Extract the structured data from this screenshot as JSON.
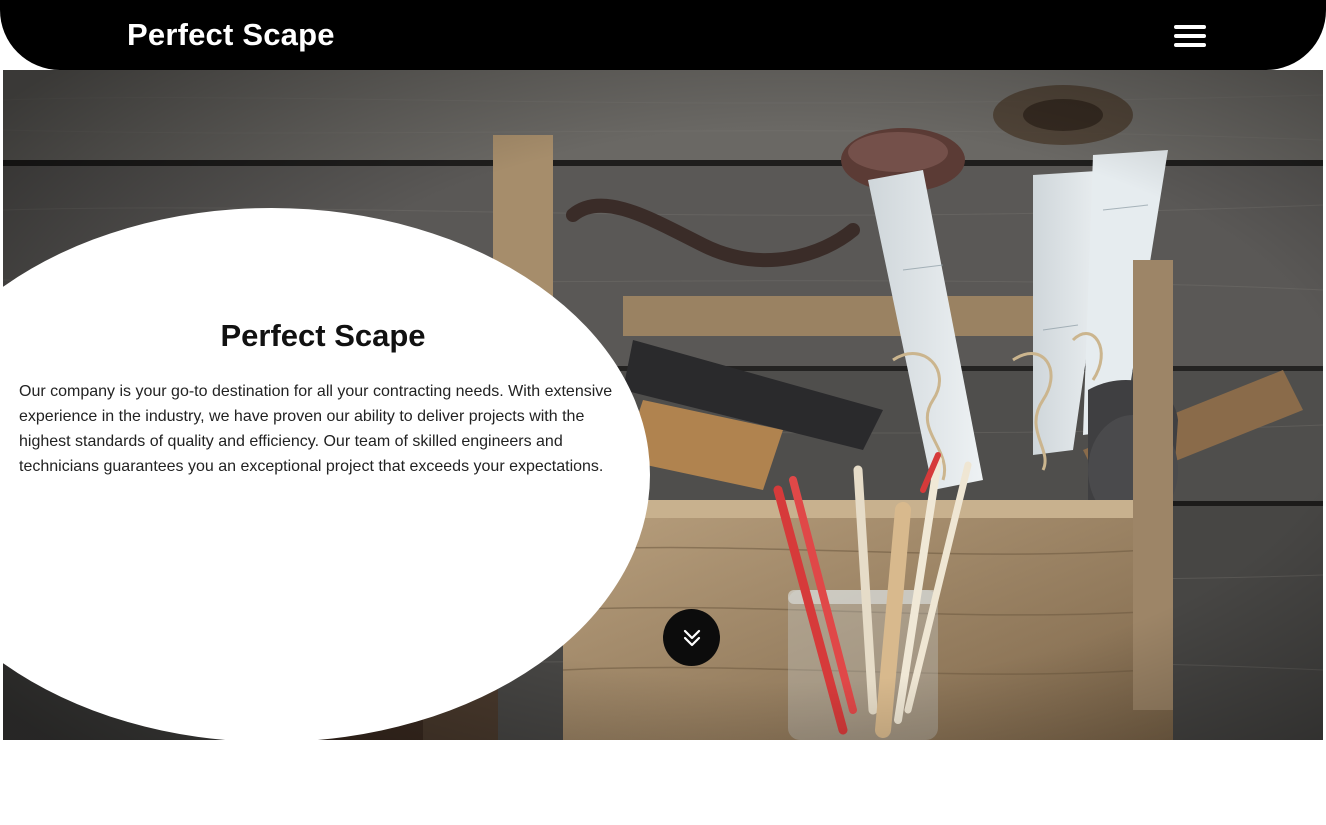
{
  "header": {
    "brand": "Perfect Scape",
    "menu_icon": "hamburger-menu-icon"
  },
  "hero": {
    "image_subject": "wooden toolbox with hand tools, blueprints and pencils on rustic planks",
    "title": "Perfect Scape",
    "description": "Our company is your go-to destination for all your contracting needs. With extensive experience in the industry, we have proven our ability to deliver projects with the highest standards of quality and efficiency. Our team of skilled engineers and technicians guarantees you an exceptional project that exceeds your expectations.",
    "scroll_icon": "double-chevron-down-icon"
  },
  "colors": {
    "header_bg": "#000000",
    "text_dark": "#111111",
    "panel_bg": "#ffffff"
  }
}
